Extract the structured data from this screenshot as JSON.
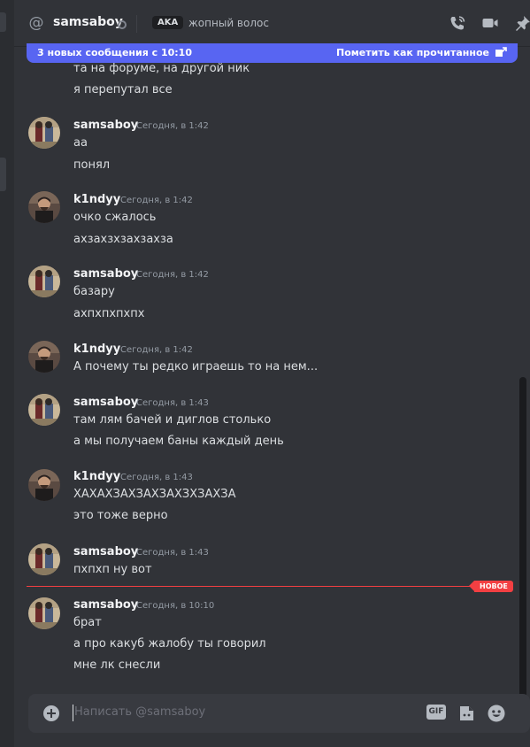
{
  "header": {
    "username": "samsaboy",
    "aka_label": "AKA",
    "nickname": "жопный волос"
  },
  "banner": {
    "new_messages": "3 новых сообщения с 10:10",
    "mark_read": "Пометить как прочитанное"
  },
  "messages": [
    {
      "texts": [
        "та на форуме, на другой ник",
        "я перепутал все"
      ]
    },
    {
      "author": "samsaboy",
      "timestamp": "Сегодня, в 1:42",
      "texts": [
        "аа",
        "понял"
      ]
    },
    {
      "author": "k1ndyy",
      "timestamp": "Сегодня, в 1:42",
      "texts": [
        "очко сжалось",
        "ахзахзхзахзахза"
      ]
    },
    {
      "author": "samsaboy",
      "timestamp": "Сегодня, в 1:42",
      "texts": [
        "базару",
        "ахпхпхпхпх"
      ]
    },
    {
      "author": "k1ndyy",
      "timestamp": "Сегодня, в 1:42",
      "texts": [
        "А почему ты редко играешь то на нем..."
      ]
    },
    {
      "author": "samsaboy",
      "timestamp": "Сегодня, в 1:43",
      "texts": [
        "там лям бачей и диглов столько",
        "а мы получаем баны каждый день"
      ]
    },
    {
      "author": "k1ndyy",
      "timestamp": "Сегодня, в 1:43",
      "texts": [
        "ХАХАХЗАХЗАХЗАХЗХЗАХЗА",
        "это тоже верно"
      ]
    },
    {
      "author": "samsaboy",
      "timestamp": "Сегодня, в 1:43",
      "texts": [
        "пхпхп ну вот"
      ]
    },
    {
      "author": "samsaboy",
      "timestamp": "Сегодня, в 10:10",
      "texts": [
        "брат",
        "а про какуб жалобу ты говорил",
        "мне лк снесли"
      ]
    }
  ],
  "new_divider": "НОВОЕ",
  "composer": {
    "placeholder": "Написать @samsaboy",
    "gif_label": "GIF"
  },
  "colors": {
    "background": "#313338",
    "banner": "#5865f2",
    "new_divider": "#f23f42",
    "composer": "#383a40"
  }
}
